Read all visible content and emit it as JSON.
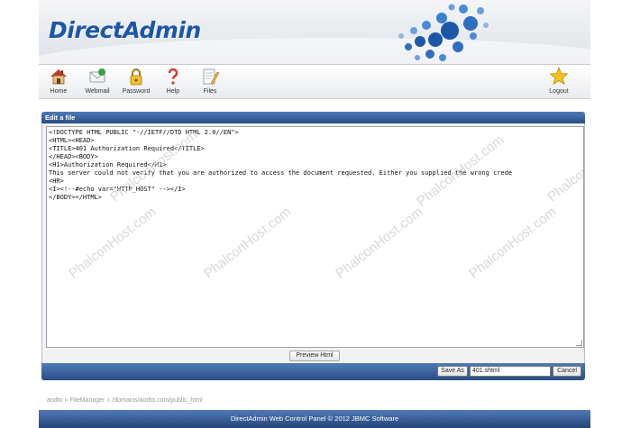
{
  "header": {
    "logo_text": "DirectAdmin",
    "brand_color": "#1d57a8"
  },
  "nav": [
    {
      "label": "Home",
      "icon": "home-icon"
    },
    {
      "label": "Webmail",
      "icon": "webmail-icon"
    },
    {
      "label": "Password",
      "icon": "lock-icon"
    },
    {
      "label": "Help",
      "icon": "help-icon"
    },
    {
      "label": "Files",
      "icon": "files-icon"
    },
    {
      "label": "Logout",
      "icon": "star-icon"
    }
  ],
  "panel": {
    "title": "Edit a file"
  },
  "editor": {
    "content": "<!DOCTYPE HTML PUBLIC \"-//IETF//DTD HTML 2.0//EN\">\n<HTML><HEAD>\n<TITLE>401 Authorization Required</TITLE>\n</HEAD><BODY>\n<H1>Authorization Required</H1>\nThis server could not verify that you are authorized to access the document requested. Either you supplied the wrong crede\n<HR>\n<I><!--#echo var=\"HTTP_HOST\" --></I>\n</BODY></HTML>",
    "watermark": "PhalconHost.com"
  },
  "buttons": {
    "preview": "Preview Html",
    "save_as": "Save As",
    "cancel": "Cancel"
  },
  "filename_value": "401.shtml",
  "breadcrumb": [
    "aodto",
    "FileManager",
    "/domains/aodto.com/public_html"
  ],
  "breadcrumb_sep": "»",
  "footer": {
    "text": "DirectAdmin Web Control Panel © 2012 JBMC Software"
  },
  "colors": {
    "bar_top": "#4f7ab8",
    "bar_bottom": "#2a4e86"
  }
}
